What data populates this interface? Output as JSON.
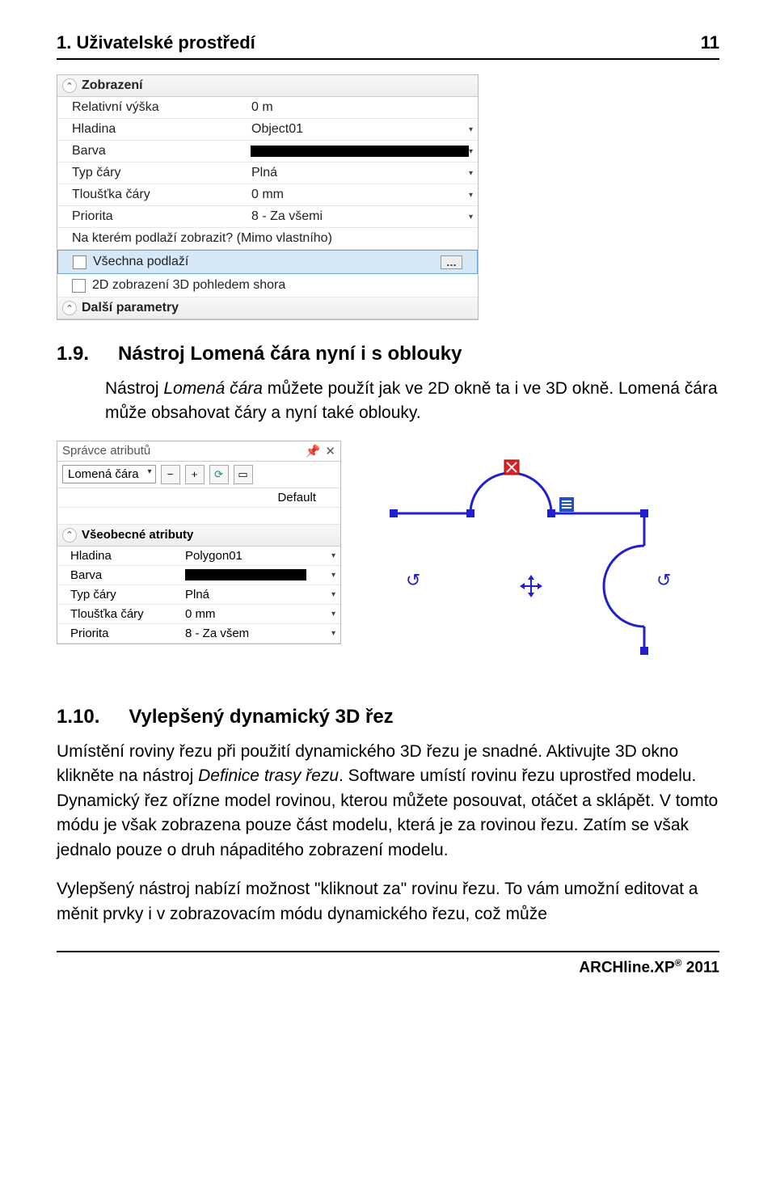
{
  "header": {
    "title": "1. Uživatelské prostředí",
    "page_num": "11"
  },
  "panel1": {
    "title": "Zobrazení",
    "rows": {
      "relVyska": {
        "label": "Relativní výška",
        "value": "0 m"
      },
      "hladina": {
        "label": "Hladina",
        "value": "Object01"
      },
      "barva": {
        "label": "Barva"
      },
      "typCary": {
        "label": "Typ čáry",
        "value": "Plná"
      },
      "tloustka": {
        "label": "Tloušťka čáry",
        "value": "0 mm"
      },
      "priorita": {
        "label": "Priorita",
        "value": "8 - Za všemi"
      },
      "podlazi_q": "Na kterém podlaží zobrazit? (Mimo vlastního)",
      "vsechna": "Všechna podlaží",
      "zobrazeni2d": "2D zobrazení 3D pohledem shora"
    },
    "title2": "Další parametry"
  },
  "section1": {
    "num": "1.9.",
    "title": "Nástroj Lomená čára nyní i s oblouky",
    "para": [
      "Nástroj ",
      "Lomená čára",
      " můžete použít jak ve 2D okně ta i ve 3D okně. Lomená čára může obsahovat čáry a nyní také oblouky."
    ]
  },
  "attr_panel": {
    "title": "Správce atributů",
    "type": "Lomená čára",
    "default_label": "Default",
    "section": "Všeobecné atributy",
    "rows": {
      "hladina": {
        "label": "Hladina",
        "value": "Polygon01"
      },
      "barva": {
        "label": "Barva"
      },
      "typCary": {
        "label": "Typ čáry",
        "value": "Plná"
      },
      "tloustka": {
        "label": "Tloušťka čáry",
        "value": "0 mm"
      },
      "priorita": {
        "label": "Priorita",
        "value": "8 - Za všem"
      }
    }
  },
  "section2": {
    "num": "1.10.",
    "title": "Vylepšený dynamický 3D řez",
    "para1": [
      "Umístění roviny řezu při použití dynamického 3D řezu je snadné. Aktivujte 3D okno klikněte na nástroj ",
      "Definice trasy řezu",
      ". Software umístí rovinu řezu uprostřed modelu. Dynamický řez ořízne model rovinou, kterou můžete posouvat, otáčet a sklápět. V tomto módu je však zobrazena pouze část modelu, která je za rovinou řezu. Zatím se však jednalo pouze o druh nápaditého zobrazení modelu."
    ],
    "para2": "Vylepšený nástroj nabízí možnost \"kliknout za\" rovinu řezu. To vám umožní editovat a měnit prvky i v zobrazovacím módu dynamického řezu, což může"
  },
  "footer": {
    "product": "ARCHline.XP",
    "reg": "®",
    "year": "2011"
  }
}
